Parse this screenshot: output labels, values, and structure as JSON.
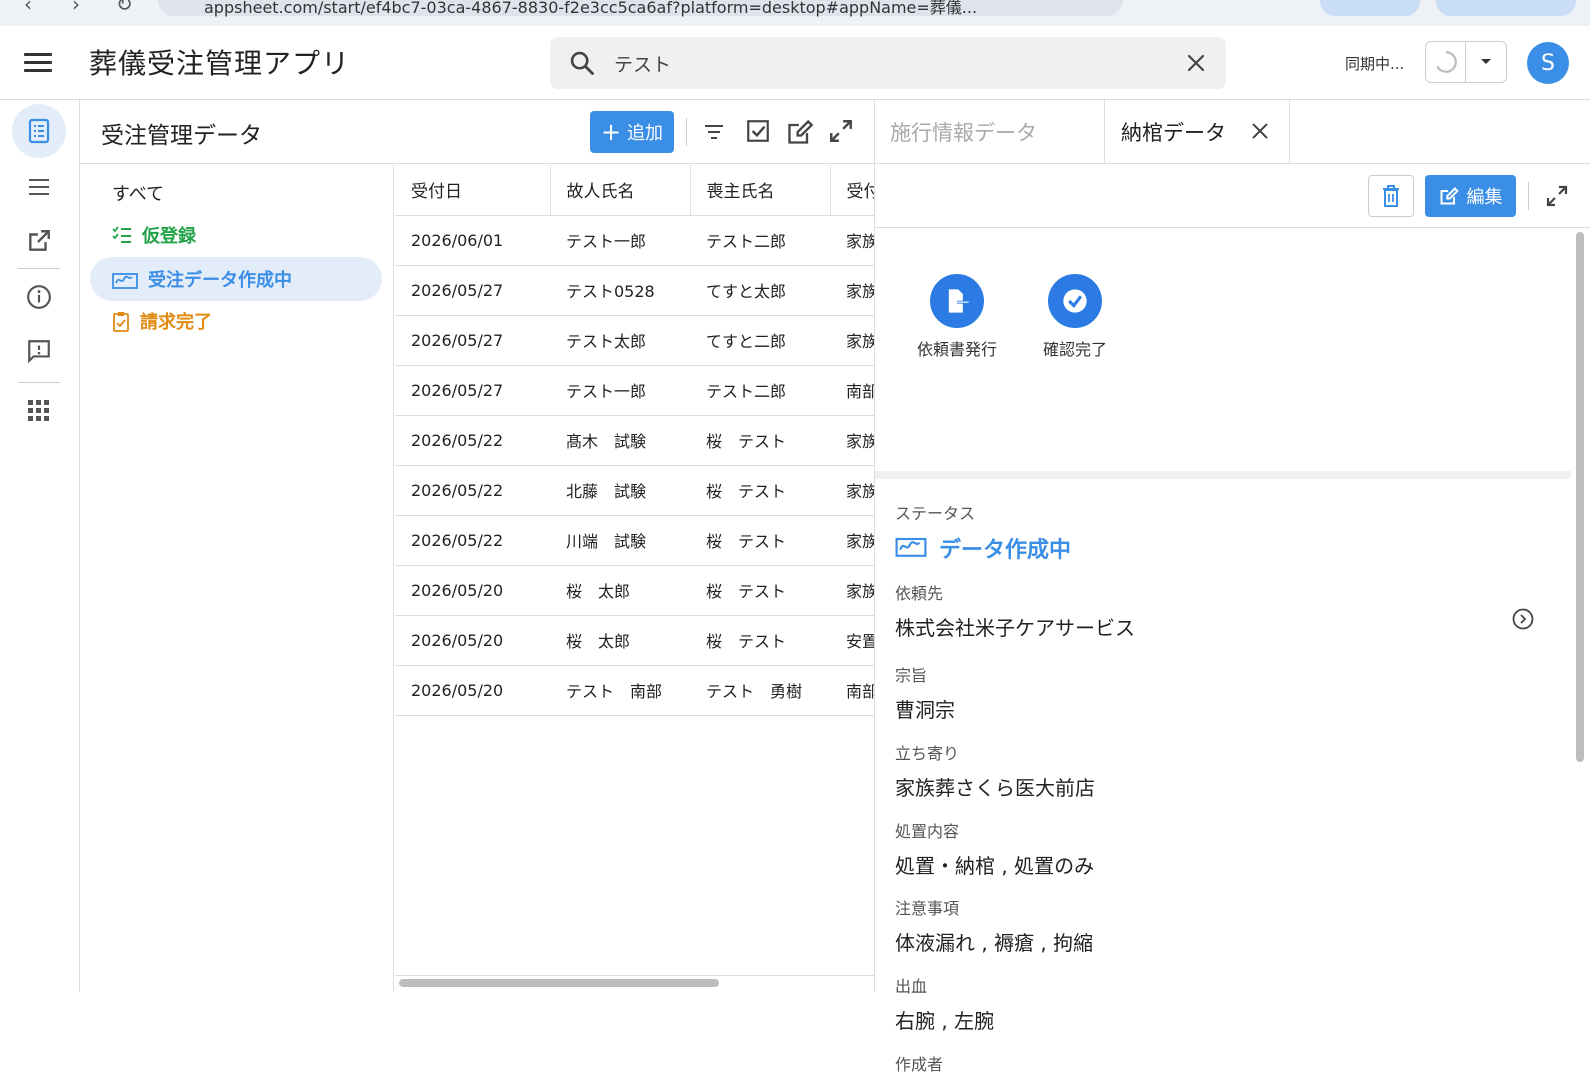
{
  "browser": {
    "url": "appsheet.com/start/ef4bc7-03ca-4867-8830-f2e3cc5ca6af?platform=desktop#appName=葬儀..."
  },
  "header": {
    "title": "葬儀受注管理アプリ",
    "search_value": "テスト",
    "sync_text": "同期中...",
    "avatar_initial": "S"
  },
  "list": {
    "title": "受注管理データ",
    "add_label": "追加",
    "filters": [
      {
        "label": "すべて"
      },
      {
        "label": "仮登録",
        "color": "#22a34a"
      },
      {
        "label": "受注データ作成中",
        "color": "#3a8ee6"
      },
      {
        "label": "請求完了",
        "color": "#e08b12"
      }
    ],
    "columns": [
      "受付日",
      "故人氏名",
      "喪主氏名",
      "受付"
    ],
    "rows": [
      [
        "2026/06/01",
        "テスト一郎",
        "テスト二郎",
        "家族"
      ],
      [
        "2026/05/27",
        "テスト0528",
        "てすと太郎",
        "家族"
      ],
      [
        "2026/05/27",
        "テスト太郎",
        "てすと二郎",
        "家族"
      ],
      [
        "2026/05/27",
        "テスト一郎",
        "テスト二郎",
        "南部"
      ],
      [
        "2026/05/22",
        "髙木　試験",
        "桜　テスト",
        "家族"
      ],
      [
        "2026/05/22",
        "北藤　試験",
        "桜　テスト",
        "家族"
      ],
      [
        "2026/05/22",
        "川端　試験",
        "桜　テスト",
        "家族"
      ],
      [
        "2026/05/20",
        "桜　太郎",
        "桜　テスト",
        "家族"
      ],
      [
        "2026/05/20",
        "桜　太郎",
        "桜　テスト",
        "安置"
      ],
      [
        "2026/05/20",
        "テスト　南部",
        "テスト　勇樹",
        "南部"
      ]
    ]
  },
  "detail": {
    "tab_inactive": "施行情報データ",
    "tab_active": "納棺データ",
    "edit_label": "編集",
    "actions": [
      {
        "label": "依頼書発行",
        "icon": "file-export-icon"
      },
      {
        "label": "確認完了",
        "icon": "check-circle-icon"
      }
    ],
    "fields": {
      "status": {
        "label": "ステータス",
        "value": "データ作成中"
      },
      "client": {
        "label": "依頼先",
        "value": "株式会社米子ケアサービス"
      },
      "sect": {
        "label": "宗旨",
        "value": "曹洞宗"
      },
      "stopover": {
        "label": "立ち寄り",
        "value": "家族葬さくら医大前店"
      },
      "treatment": {
        "label": "処置内容",
        "value": "処置・納棺 , 処置のみ"
      },
      "notes": {
        "label": "注意事項",
        "value": "体液漏れ , 褥瘡 , 拘縮"
      },
      "bleeding": {
        "label": "出血",
        "value": "右腕 , 左腕"
      },
      "author": {
        "label": "作成者"
      }
    }
  },
  "colors": {
    "accent": "#3a8ee6",
    "green": "#22a34a",
    "orange": "#e08b12"
  }
}
